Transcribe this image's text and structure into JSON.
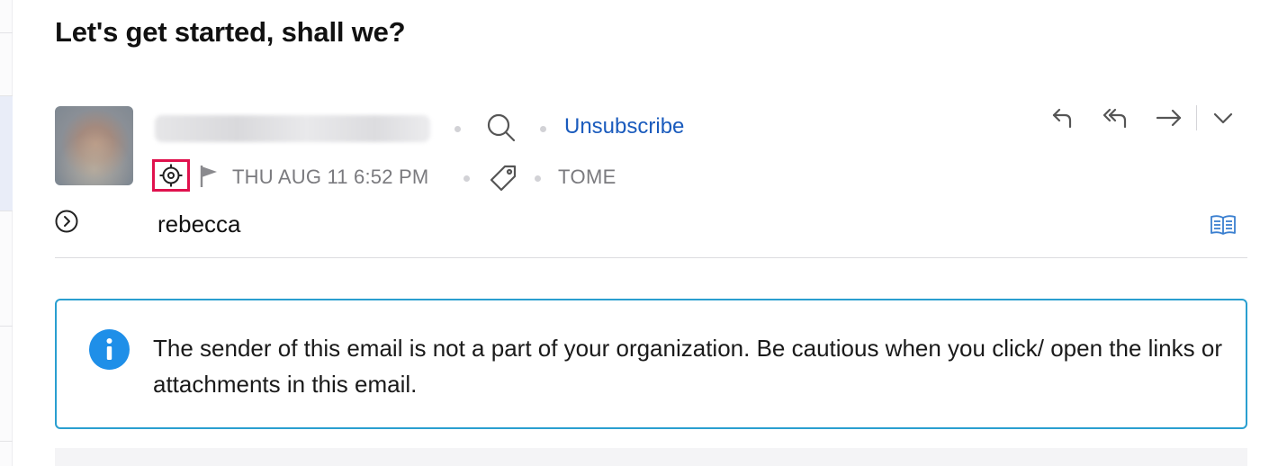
{
  "email": {
    "subject": "Let's get started, shall we?",
    "unsubscribe_label": "Unsubscribe",
    "date": "THU AUG 11 6:52 PM",
    "folder": "TOME",
    "recipient": "rebecca"
  },
  "notice": {
    "text": "The sender of this email is not a part of your organization. Be cautious when you click/ open the links or attachments in this email."
  },
  "icons": {
    "search": "search-icon",
    "focus": "focus-target-icon",
    "flag": "flag-icon",
    "tag": "tag-icon",
    "expand": "chevron-right-circle-icon",
    "reply": "reply-icon",
    "reply_all": "reply-all-icon",
    "forward": "forward-icon",
    "more": "chevron-down-icon",
    "reading_mode": "open-book-icon",
    "info": "info-icon"
  },
  "colors": {
    "link": "#1a5bbd",
    "highlight_border": "#e0114d",
    "notice_border": "#2a9fd0",
    "info_icon": "#1f8fe8",
    "muted_text": "#7a7a7e"
  }
}
